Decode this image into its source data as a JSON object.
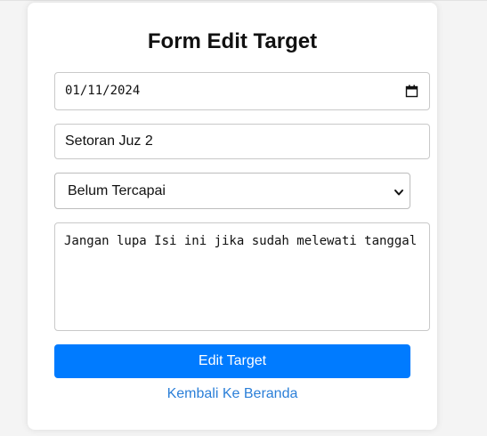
{
  "form": {
    "title": "Form Edit Target",
    "date_value": "01/11/2024",
    "target_name": "Setoran Juz 2",
    "status_selected": "Belum Tercapai",
    "note": "Jangan lupa Isi ini jika sudah melewati tanggal",
    "submit_label": "Edit Target",
    "back_label": "Kembali Ke Beranda"
  },
  "icons": {
    "date": "calendar-icon",
    "select": "chevron-down-icon"
  },
  "colors": {
    "primary": "#007bff",
    "link": "#2b7fd8",
    "background": "#f4f4f4",
    "card": "#ffffff"
  }
}
